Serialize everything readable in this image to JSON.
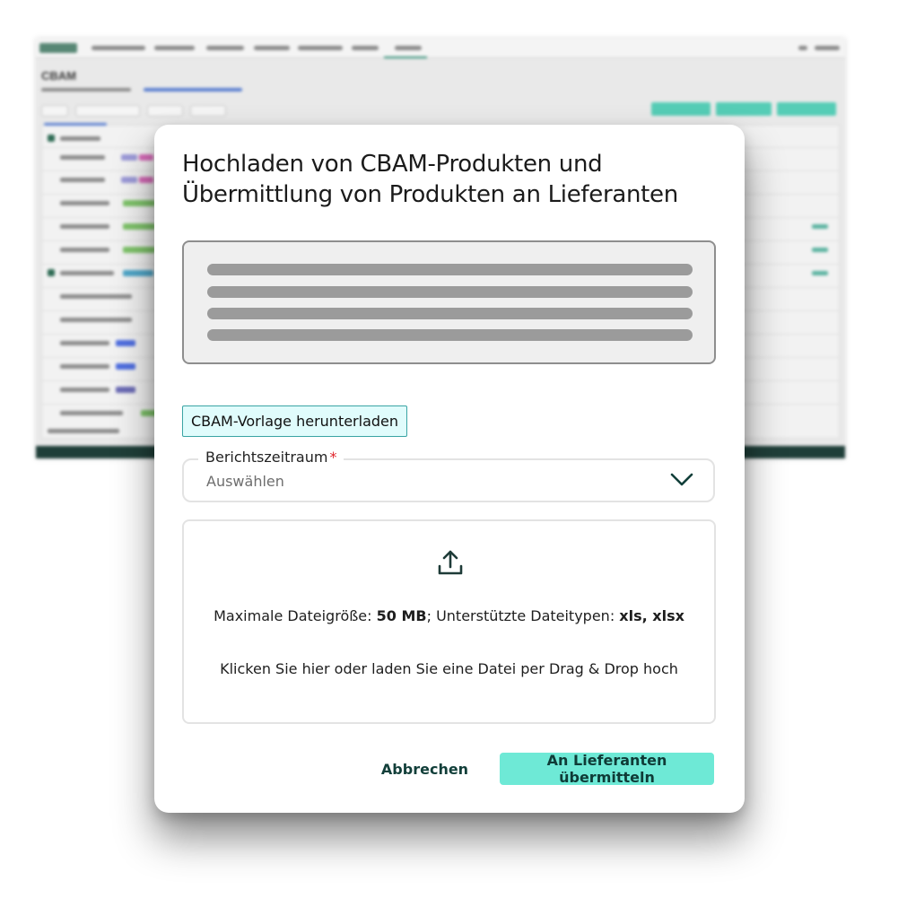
{
  "modal": {
    "title": "Hochladen von CBAM-Produkten und Übermittlung von Produkten an Lieferanten",
    "template_button": "CBAM-Vorlage herunterladen",
    "period_field": {
      "label": "Berichtszeitraum",
      "required_marker": "*",
      "value": "Auswählen"
    },
    "upload": {
      "max_size_label": "Maximale Dateigröße:",
      "max_size_value": "50 MB",
      "types_label": "; Unterstützte Dateitypen:",
      "types_value": "xls, xlsx",
      "hint": "Klicken Sie hier oder laden Sie eine Datei per Drag & Drop hoch"
    },
    "cancel_label": "Abbrechen",
    "submit_label": "An Lieferanten übermitteln"
  },
  "background": {
    "page_title": "CBAM"
  },
  "icons": {
    "upload": "upload-icon",
    "chevron": "chevron-down-icon"
  },
  "colors": {
    "accent": "#6ee9d6",
    "template_button_bg": "#e0fcfc",
    "required": "#e0242b",
    "dark_text": "#123f3a"
  }
}
